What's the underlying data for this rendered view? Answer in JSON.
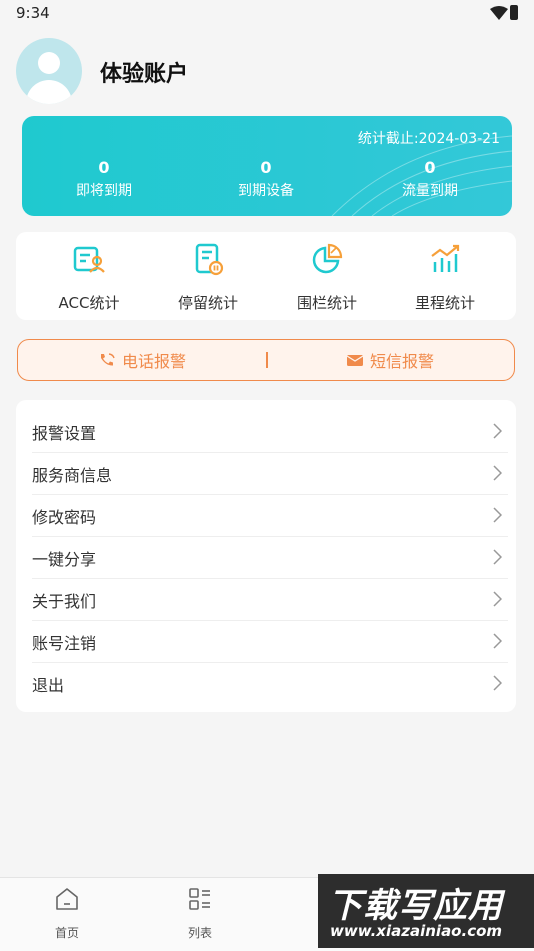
{
  "status_bar": {
    "time": "9:34"
  },
  "profile": {
    "name": "体验账户"
  },
  "stats": {
    "as_of": "统计截止:2024-03-21",
    "items": [
      {
        "value": "0",
        "label": "即将到期"
      },
      {
        "value": "0",
        "label": "到期设备"
      },
      {
        "value": "0",
        "label": "流量到期"
      }
    ]
  },
  "quick_actions": [
    {
      "label": "ACC统计",
      "icon": "acc-person-icon"
    },
    {
      "label": "停留统计",
      "icon": "document-clock-icon"
    },
    {
      "label": "围栏统计",
      "icon": "pie-chart-icon"
    },
    {
      "label": "里程统计",
      "icon": "bar-chart-icon"
    }
  ],
  "alarm": {
    "phone": "电话报警",
    "sms": "短信报警"
  },
  "menu": [
    {
      "label": "报警设置"
    },
    {
      "label": "服务商信息"
    },
    {
      "label": "修改密码"
    },
    {
      "label": "一键分享"
    },
    {
      "label": "关于我们"
    },
    {
      "label": "账号注销"
    },
    {
      "label": "退出"
    }
  ],
  "tabbar": [
    {
      "label": "首页",
      "icon": "home-icon"
    },
    {
      "label": "列表",
      "icon": "list-icon"
    }
  ],
  "watermark": {
    "line1": "下载写应用",
    "line2": "www.xiazainiao.com"
  },
  "colors": {
    "accent": "#1fc9cf",
    "alarm": "#f08a4b",
    "background": "#f5f5f5"
  }
}
